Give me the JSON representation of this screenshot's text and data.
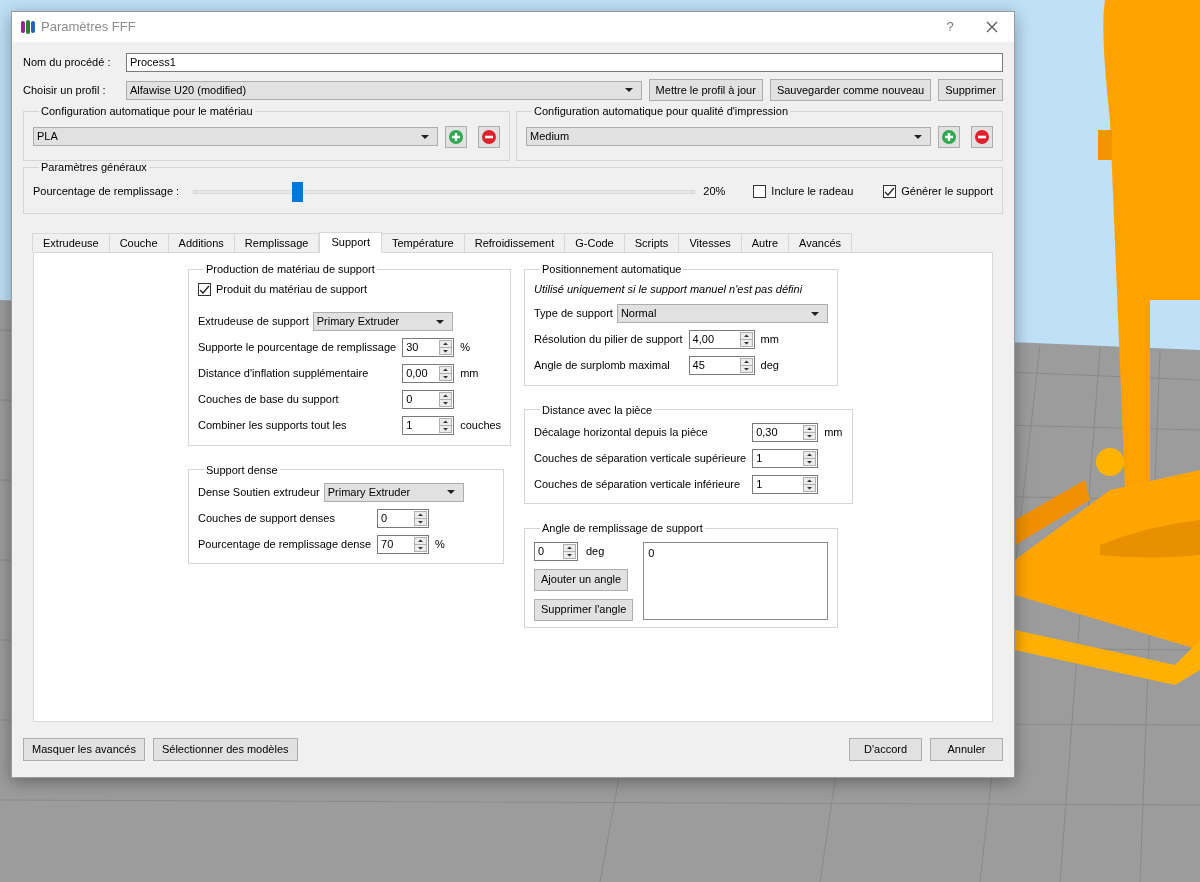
{
  "window": {
    "title": "Paramètres FFF",
    "help": "?"
  },
  "process": {
    "label": "Nom du procédé :",
    "value": "Process1"
  },
  "profile": {
    "label": "Choisir un profil :",
    "value": "Alfawise U20 (modified)",
    "buttons": [
      "Mettre le profil à jour",
      "Sauvegarder comme nouveau",
      "Supprimer"
    ]
  },
  "auto_config": [
    {
      "title": "Configuration automatique pour le matériau",
      "value": "PLA"
    },
    {
      "title": "Configuration automatique pour qualité d'impression",
      "value": "Medium"
    }
  ],
  "general": {
    "title": "Paramètres généraux",
    "infill_label": "Pourcentage de remplissage :",
    "infill_slider": {
      "level": 0.2
    },
    "infill_reading": "20%",
    "checkboxes": [
      {
        "label": "Inclure le radeau",
        "checked": false
      },
      {
        "label": "Générer le support",
        "checked": true
      }
    ]
  },
  "tabs": [
    {
      "label": "Extrudeuse",
      "selected": false
    },
    {
      "label": "Couche",
      "selected": false
    },
    {
      "label": "Additions",
      "selected": false
    },
    {
      "label": "Remplissage",
      "selected": false
    },
    {
      "label": "Support",
      "selected": true
    },
    {
      "label": "Température",
      "selected": false
    },
    {
      "label": "Refroidissement",
      "selected": false
    },
    {
      "label": "G-Code",
      "selected": false
    },
    {
      "label": "Scripts",
      "selected": false
    },
    {
      "label": "Vitesses",
      "selected": false
    },
    {
      "label": "Autre",
      "selected": false
    },
    {
      "label": "Avancés",
      "selected": false
    }
  ],
  "left_column": [
    {
      "title": "Production de matériau de support",
      "rows": [
        {
          "kind": "check",
          "label": "Produit du matériau de support",
          "checked": true
        },
        {
          "kind": "combo",
          "label": "Extrudeuse de support",
          "value": "Primary Extruder"
        },
        {
          "kind": "spin",
          "label": "Supporte le pourcentage de remplissage",
          "value": "30",
          "unit": "%"
        },
        {
          "kind": "spin",
          "label": "Distance d'inflation supplémentaire",
          "value": "0,00",
          "unit": "mm"
        },
        {
          "kind": "spin",
          "label": "Couches de base du support",
          "value": "0"
        },
        {
          "kind": "spin",
          "label": "Combiner les supports tout les",
          "value": "1",
          "unit": "couches"
        }
      ]
    },
    {
      "title": "Support dense",
      "rows": [
        {
          "kind": "combo",
          "label": "Dense Soutien extrudeur",
          "value": "Primary Extruder"
        },
        {
          "kind": "spin",
          "label": "Couches de support denses",
          "value": "0"
        },
        {
          "kind": "spin",
          "label": "Pourcentage de remplissage dense",
          "value": "70",
          "unit": "%"
        }
      ]
    }
  ],
  "right_column": [
    {
      "title": "Positionnement automatique",
      "rows": [
        {
          "kind": "note",
          "label": "Utilisé uniquement si le support manuel n'est pas défini"
        },
        {
          "kind": "combo",
          "label": "Type de support",
          "value": "Normal"
        },
        {
          "kind": "spin",
          "label": "Résolution du pilier de support",
          "value": "4,00",
          "unit": "mm"
        },
        {
          "kind": "spin",
          "label": "Angle de surplomb maximal",
          "value": "45",
          "unit": "deg"
        }
      ]
    },
    {
      "title": "Distance avec la pièce",
      "rows": [
        {
          "kind": "spin",
          "label": "Décalage horizontal depuis la pièce",
          "value": "0,30",
          "unit": "mm"
        },
        {
          "kind": "spin",
          "label": "Couches de séparation verticale supérieure",
          "value": "1"
        },
        {
          "kind": "spin",
          "label": "Couches de séparation verticale inférieure",
          "value": "1"
        }
      ]
    },
    {
      "title": "Angle de remplissage de support",
      "rows": [
        {
          "kind": "angle",
          "value": "0",
          "unit": "deg",
          "buttons": [
            "Ajouter un angle",
            "Supprimer l'angle"
          ],
          "list": [
            "0"
          ]
        }
      ]
    }
  ],
  "footer": {
    "left_buttons": [
      "Masquer les avancés",
      "Sélectionner des modèles"
    ],
    "right_buttons": [
      "D'accord",
      "Annuler"
    ]
  }
}
